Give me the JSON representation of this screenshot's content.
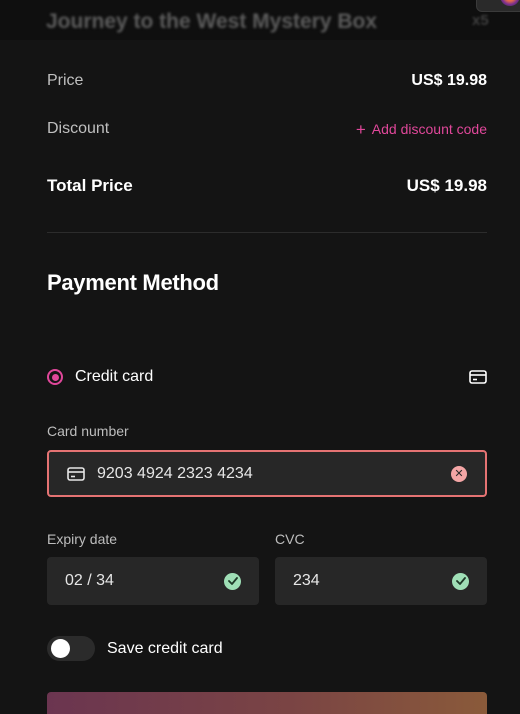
{
  "product": {
    "title": "Journey to the West Mystery Box",
    "quantity": "x5"
  },
  "summary": {
    "price_label": "Price",
    "price_value": "US$ 19.98",
    "discount_label": "Discount",
    "discount_link": "Add discount code",
    "total_label": "Total Price",
    "total_value": "US$ 19.98"
  },
  "payment": {
    "section_title": "Payment Method",
    "method_label": "Credit card",
    "method_selected": true,
    "card_number_label": "Card number",
    "card_number_value": "9203 4924 2323 4234",
    "expiry_label": "Expiry date",
    "expiry_value": "02 / 34",
    "cvc_label": "CVC",
    "cvc_value": "234",
    "save_card_label": "Save credit card",
    "save_card_enabled": false
  },
  "colors": {
    "background": "#141414",
    "accent": "#e0479a",
    "error_border": "#e57373",
    "success": "#9fdfb6"
  },
  "icons": {
    "card": "credit-card-icon",
    "clear": "clear-icon",
    "valid": "check-circle-icon",
    "add": "plus-icon"
  }
}
